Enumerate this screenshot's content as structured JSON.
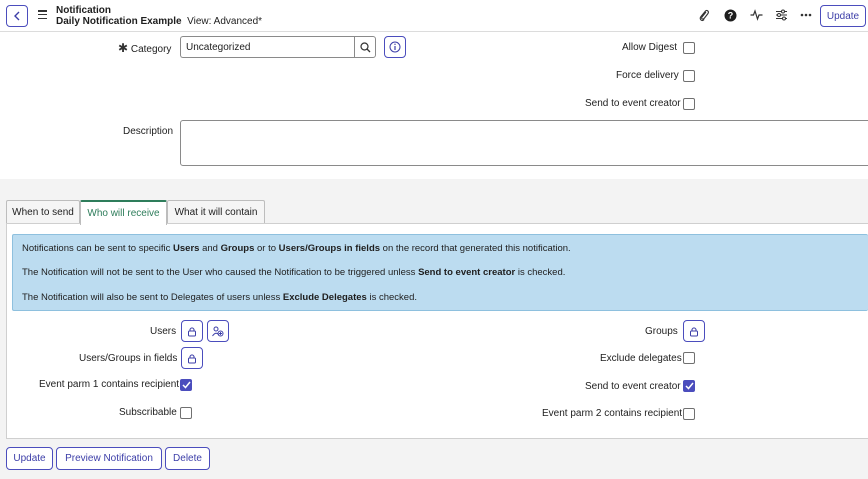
{
  "header": {
    "title": "Notification",
    "record_name": "Daily Notification Example",
    "view_label": "View: Advanced*",
    "update_label": "Update"
  },
  "form": {
    "category_label": "Category",
    "category_value": "Uncategorized",
    "allow_digest_label": "Allow Digest",
    "force_delivery_label": "Force delivery",
    "send_to_event_creator_label": "Send to event creator",
    "description_label": "Description"
  },
  "tabs": [
    {
      "label": "When to send"
    },
    {
      "label": "Who will receive"
    },
    {
      "label": "What it will contain"
    }
  ],
  "info": {
    "line1": {
      "a": "Notifications can be sent to specific ",
      "b": "Users",
      "c": " and ",
      "d": "Groups",
      "e": " or to ",
      "f": "Users/Groups in fields",
      "g": " on the record that generated this notification."
    },
    "line2": {
      "a": "The Notification will not be sent to the User who caused the Notification to be triggered unless ",
      "b": "Send to event creator",
      "c": " is checked."
    },
    "line3": {
      "a": "The Notification will also be sent to Delegates of users unless ",
      "b": "Exclude Delegates",
      "c": " is checked."
    }
  },
  "recipients": {
    "users_label": "Users",
    "users_groups_fields_label": "Users/Groups in fields",
    "event_parm1_label": "Event parm 1 contains recipient",
    "event_parm1_checked": true,
    "subscribable_label": "Subscribable",
    "subscribable_checked": false,
    "groups_label": "Groups",
    "exclude_delegates_label": "Exclude delegates",
    "exclude_delegates_checked": false,
    "send_to_event_creator_label": "Send to event creator",
    "send_to_event_creator_checked": true,
    "event_parm2_label": "Event parm 2 contains recipient",
    "event_parm2_checked": false
  },
  "buttons": {
    "update": "Update",
    "preview": "Preview Notification",
    "delete": "Delete"
  },
  "colors": {
    "accent": "#4b4dbd",
    "tab_active": "#2e7d5b",
    "info_bg": "#bcdcf0"
  }
}
